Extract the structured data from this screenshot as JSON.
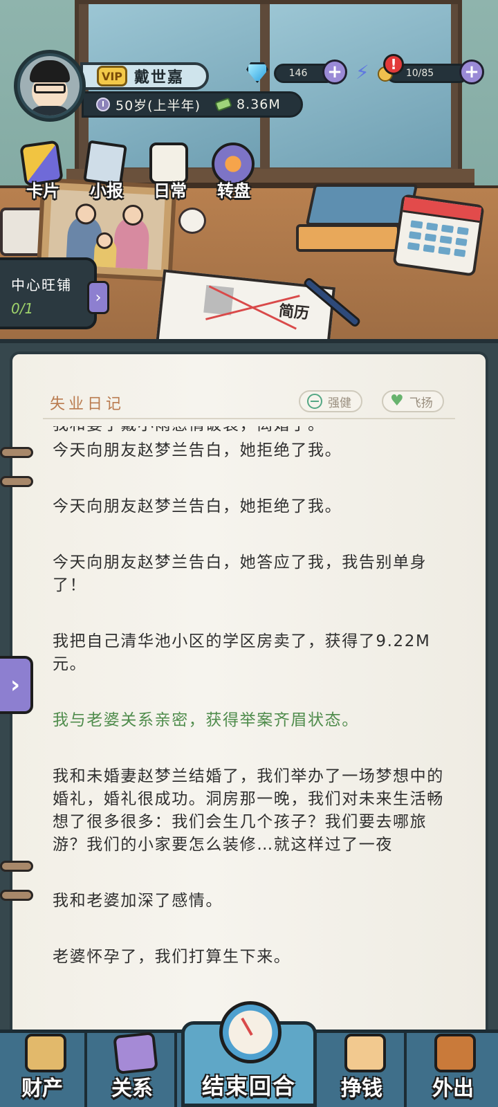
{
  "player": {
    "name": "戴世嘉",
    "vip_label": "VIP",
    "age": "50岁(上半年)",
    "cash": "8.36M"
  },
  "resources": {
    "gems": "146",
    "energy": "10/85",
    "alert_mark": "!"
  },
  "quick_menu": [
    {
      "label": "卡片",
      "icon": "cards-icon"
    },
    {
      "label": "小报",
      "icon": "newspaper-icon"
    },
    {
      "label": "日常",
      "icon": "clipboard-icon"
    },
    {
      "label": "转盘",
      "icon": "wheel-icon"
    }
  ],
  "event": {
    "title": "中心旺铺",
    "progress": "0/1"
  },
  "scene": {
    "resume_mark": "简历"
  },
  "diary": {
    "title": "失业日记",
    "states": [
      "强健",
      "飞扬"
    ],
    "entries": [
      {
        "text": "我和妻子戴小雨感情破裂，离婚了。",
        "highlight": false
      },
      {
        "text": "今天向朋友赵梦兰告白，她拒绝了我。",
        "highlight": false
      },
      {
        "text": "今天向朋友赵梦兰告白，她拒绝了我。",
        "highlight": false
      },
      {
        "text": "今天向朋友赵梦兰告白，她答应了我，我告别单身了！",
        "highlight": false
      },
      {
        "text": "我把自己清华池小区的学区房卖了，获得了9.22M元。",
        "highlight": false
      },
      {
        "text": "我与老婆关系亲密，获得举案齐眉状态。",
        "highlight": true
      },
      {
        "text": "我和未婚妻赵梦兰结婚了，我们举办了一场梦想中的婚礼，婚礼很成功。洞房那一晚，我们对未来生活畅想了很多很多：我们会生几个孩子？我们要去哪旅游？我们的小家要怎么装修…就这样过了一夜",
        "highlight": false
      },
      {
        "text": "我和老婆加深了感情。",
        "highlight": false
      },
      {
        "text": "老婆怀孕了，我们打算生下来。",
        "highlight": false
      }
    ]
  },
  "nav": {
    "assets": "财产",
    "relations": "关系",
    "end_turn": "结束回合",
    "earn": "挣钱",
    "go_out": "外出"
  },
  "colors": {
    "accent_purple": "#8d7fd0",
    "highlight_green": "#4f8c4c",
    "title_brown": "#b97a4e"
  }
}
